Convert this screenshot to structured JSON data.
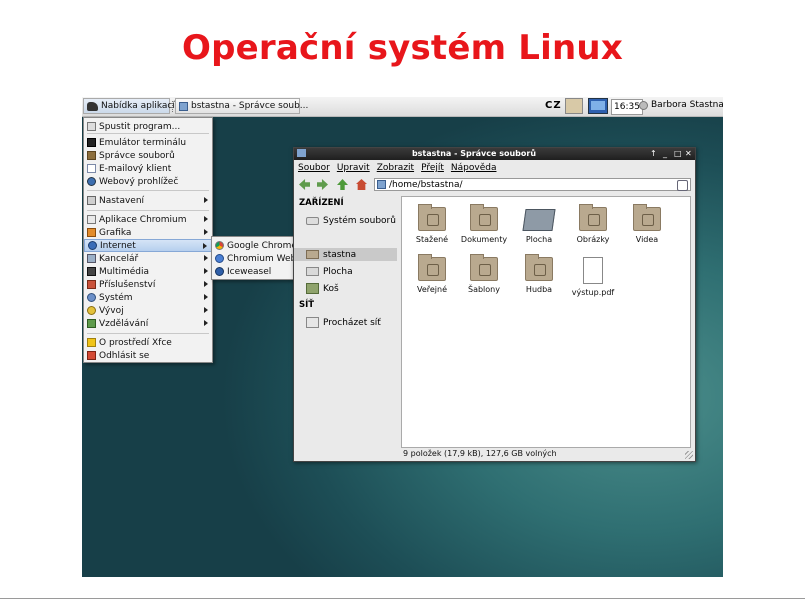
{
  "slide": {
    "title": "Operační systém Linux"
  },
  "panel": {
    "menu_button": "Nabídka aplikací",
    "task_button": "bstastna - Správce soub...",
    "keyboard_layout": "CZ",
    "clock": "16:35",
    "user": "Barbora Stastna"
  },
  "menu": {
    "items": [
      {
        "label": "Spustit program...",
        "icon": "run-icon"
      },
      {
        "label": "Emulátor terminálu",
        "icon": "terminal-icon"
      },
      {
        "label": "Správce souborů",
        "icon": "file-manager-icon"
      },
      {
        "label": "E-mailový klient",
        "icon": "mail-icon"
      },
      {
        "label": "Webový prohlížeč",
        "icon": "web-browser-icon"
      },
      {
        "label": "Nastavení",
        "icon": "settings-icon"
      },
      {
        "label": "Aplikace Chromium",
        "icon": "chromium-apps-icon"
      },
      {
        "label": "Grafika",
        "icon": "graphics-icon"
      },
      {
        "label": "Internet",
        "icon": "internet-icon"
      },
      {
        "label": "Kancelář",
        "icon": "office-icon"
      },
      {
        "label": "Multimédia",
        "icon": "multimedia-icon"
      },
      {
        "label": "Příslušenství",
        "icon": "accessories-icon"
      },
      {
        "label": "Systém",
        "icon": "system-icon"
      },
      {
        "label": "Vývoj",
        "icon": "development-icon"
      },
      {
        "label": "Vzdělávání",
        "icon": "education-icon"
      },
      {
        "label": "O prostředí Xfce",
        "icon": "about-icon"
      },
      {
        "label": "Odhlásit se",
        "icon": "logout-icon"
      }
    ],
    "submenu": [
      {
        "label": "Google Chrome",
        "icon": "chrome-icon"
      },
      {
        "label": "Chromium Web Browser",
        "icon": "chromium-icon"
      },
      {
        "label": "Iceweasel",
        "icon": "iceweasel-icon"
      }
    ]
  },
  "window": {
    "title": "bstastna - Správce souborů",
    "controls": [
      "↑",
      "_",
      "□",
      "✕"
    ],
    "menubar": [
      "Soubor",
      "Upravit",
      "Zobrazit",
      "Přejít",
      "Nápověda"
    ],
    "location": "/home/bstastna/",
    "sidebar": {
      "devices_header": "ZAŘÍZENÍ",
      "devices": [
        {
          "label": "Systém souborů",
          "icon": "drive-icon"
        }
      ],
      "places": [
        {
          "label": "stastna",
          "icon": "home-icon"
        },
        {
          "label": "Plocha",
          "icon": "desktop-icon"
        },
        {
          "label": "Koš",
          "icon": "trash-icon"
        }
      ],
      "network_header": "SÍŤ",
      "network": [
        {
          "label": "Procházet síť",
          "icon": "network-icon"
        }
      ]
    },
    "files": [
      {
        "name": "Stažené",
        "icon": "downloads-folder-icon"
      },
      {
        "name": "Dokumenty",
        "icon": "documents-folder-icon"
      },
      {
        "name": "Plocha",
        "icon": "desktop-folder-icon"
      },
      {
        "name": "Obrázky",
        "icon": "pictures-folder-icon"
      },
      {
        "name": "Videa",
        "icon": "videos-folder-icon"
      },
      {
        "name": "Veřejné",
        "icon": "public-folder-icon"
      },
      {
        "name": "Šablony",
        "icon": "templates-folder-icon"
      },
      {
        "name": "Hudba",
        "icon": "music-folder-icon"
      },
      {
        "name": "výstup.pdf",
        "icon": "pdf-file-icon"
      }
    ],
    "status": "9 položek (17,9 kB), 127,6 GB volných"
  },
  "colors": {
    "title": "#e8161b",
    "highlight": "#b6cfee",
    "titlebar": "#2a2a2a",
    "folder": "#b9a98f"
  }
}
